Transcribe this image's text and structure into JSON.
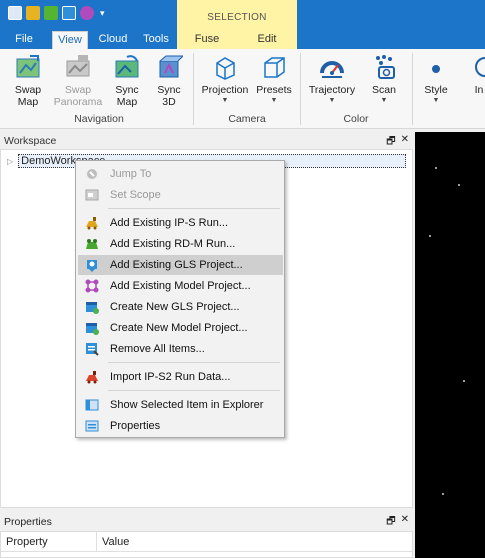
{
  "tabs": {
    "file": "File",
    "view": "View",
    "cloud": "Cloud",
    "tools": "Tools",
    "contextual_group": "SELECTION",
    "fuse": "Fuse",
    "edit": "Edit"
  },
  "ribbon": {
    "swap_map": [
      "Swap",
      "Map"
    ],
    "swap_panorama": [
      "Swap",
      "Panorama"
    ],
    "sync_map": [
      "Sync",
      "Map"
    ],
    "sync_3d": [
      "Sync",
      "3D"
    ],
    "navigation_label": "Navigation",
    "projection": "Projection",
    "presets": "Presets",
    "camera_label": "Camera",
    "trajectory": "Trajectory",
    "scan": "Scan",
    "color_label": "Color",
    "style": "Style",
    "cut_off": "In"
  },
  "workspace": {
    "title": "Workspace",
    "root_item": "DemoWorkspace"
  },
  "context_menu": {
    "items": [
      {
        "label": "Jump To",
        "icon": "jump-icon",
        "enabled": false
      },
      {
        "label": "Set Scope",
        "icon": "scope-icon",
        "enabled": false
      },
      {
        "label": "Add Existing IP-S Run...",
        "icon": "ips-run-icon",
        "enabled": true
      },
      {
        "label": "Add Existing RD-M Run...",
        "icon": "rdm-run-icon",
        "enabled": true
      },
      {
        "label": "Add Existing GLS Project...",
        "icon": "gls-project-icon",
        "enabled": true
      },
      {
        "label": "Add Existing Model Project...",
        "icon": "model-project-icon",
        "enabled": true
      },
      {
        "label": "Create New GLS Project...",
        "icon": "new-gls-icon",
        "enabled": true
      },
      {
        "label": "Create New Model Project...",
        "icon": "new-model-icon",
        "enabled": true
      },
      {
        "label": "Remove All Items...",
        "icon": "remove-icon",
        "enabled": true
      },
      {
        "label": "Import IP-S2 Run Data...",
        "icon": "import-icon",
        "enabled": true
      },
      {
        "label": "Show Selected Item in Explorer",
        "icon": "explorer-icon",
        "enabled": true
      },
      {
        "label": "Properties",
        "icon": "properties-icon",
        "enabled": true
      }
    ]
  },
  "properties": {
    "title": "Properties",
    "col_property": "Property",
    "col_value": "Value"
  },
  "colors": {
    "brand_blue": "#1c75c8",
    "context_yellow": "#fff3a6",
    "menu_highlight": "#cfcfcf"
  }
}
